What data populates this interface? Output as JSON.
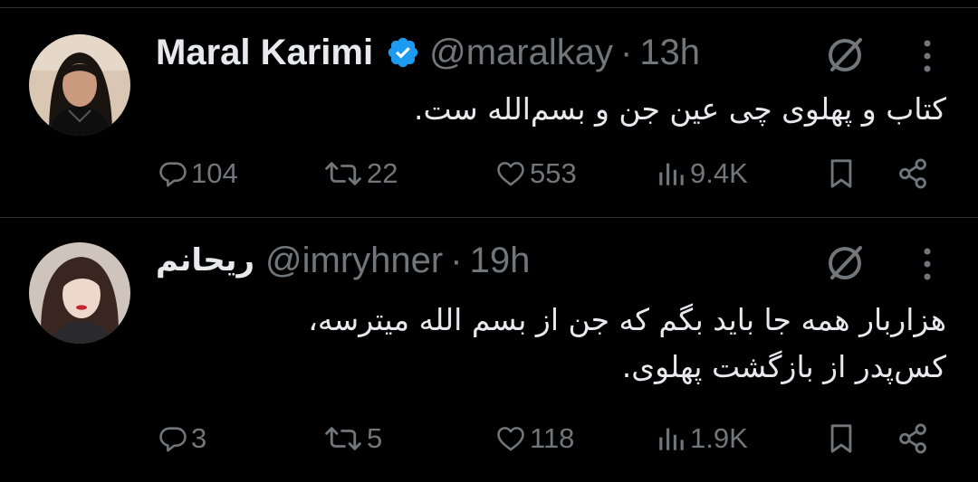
{
  "tweets": [
    {
      "author": {
        "name": "Maral Karimi",
        "verified": true,
        "handle": "@maralkay",
        "separator": "·",
        "time": "13h"
      },
      "text_lines": [
        "کتاب و پهلوی چی عین جن و بسم‌الله ست."
      ],
      "stats": {
        "replies": "104",
        "reposts": "22",
        "likes": "553",
        "views": "9.4K"
      }
    },
    {
      "author": {
        "name": "ریحانم",
        "verified": false,
        "handle": "@imryhner",
        "separator": "·",
        "time": "19h"
      },
      "text_lines": [
        "هزاربار همه جا باید بگم که جن از بسم الله میترسه،",
        "کس‌پدر از بازگشت پهلوی."
      ],
      "stats": {
        "replies": "3",
        "reposts": "5",
        "likes": "118",
        "views": "1.9K"
      }
    }
  ],
  "icons": {
    "verified": "verified-badge-icon",
    "grok": "grok-icon",
    "more": "more-vertical-icon",
    "reply": "reply-icon",
    "repost": "repost-icon",
    "like": "heart-icon",
    "views": "views-bars-icon",
    "bookmark": "bookmark-icon",
    "share": "share-icon"
  },
  "colors": {
    "background": "#000000",
    "primary_text": "#e7e9ea",
    "secondary_text": "#71767b",
    "verified_blue": "#1d9bf0",
    "divider": "#2f3336"
  }
}
